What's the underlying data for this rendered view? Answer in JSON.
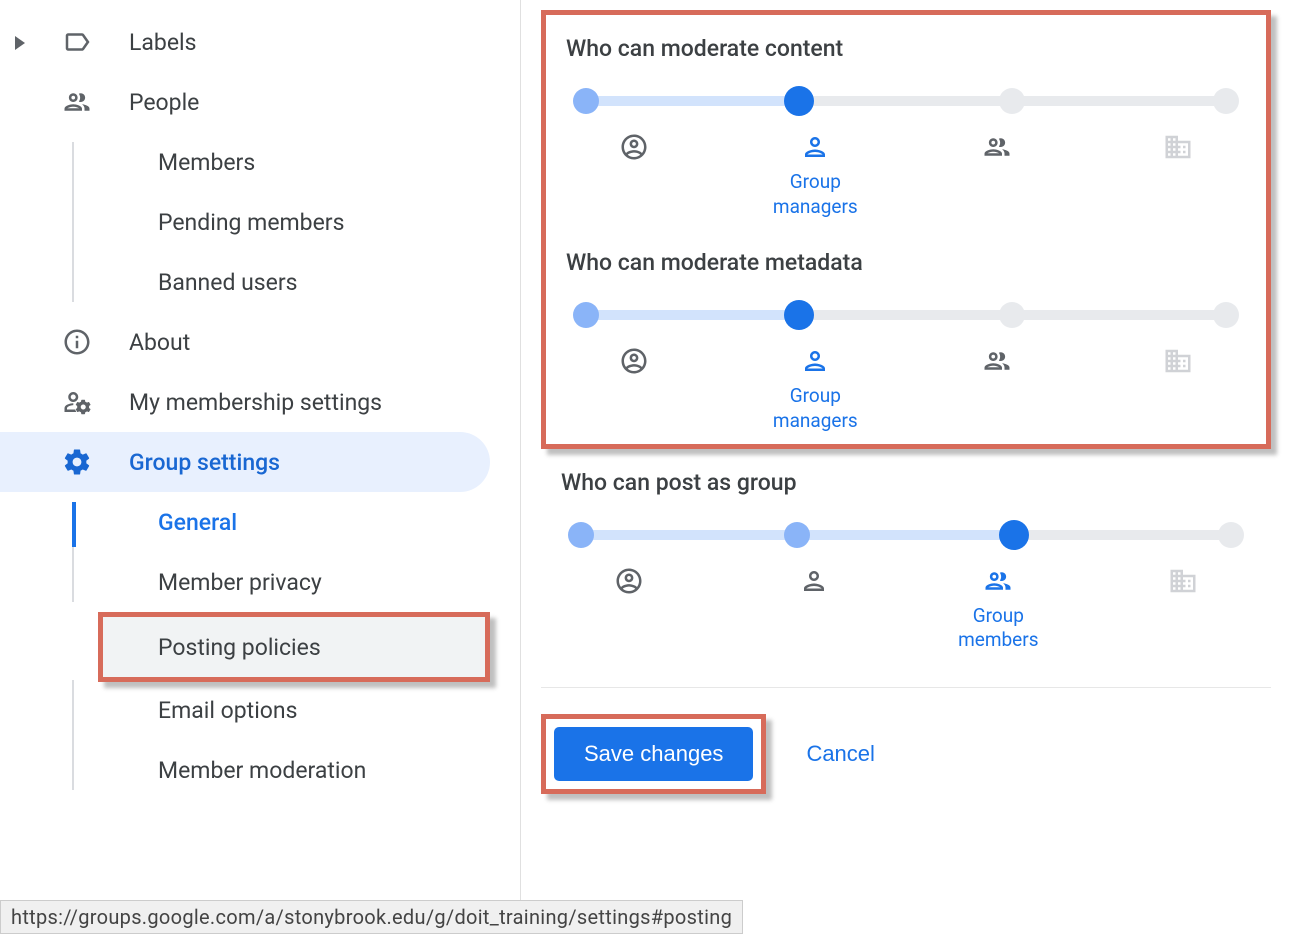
{
  "sidebar": {
    "labels": "Labels",
    "people": "People",
    "people_children": [
      "Members",
      "Pending members",
      "Banned users"
    ],
    "about": "About",
    "my_membership": "My membership settings",
    "group_settings": "Group settings",
    "settings_children": [
      "General",
      "Member privacy",
      "Posting policies",
      "Email options",
      "Member moderation"
    ]
  },
  "main": {
    "sections": [
      {
        "title": "Who can moderate content",
        "selected_index": 1,
        "labels": [
          "",
          "Group managers",
          "",
          ""
        ]
      },
      {
        "title": "Who can moderate metadata",
        "selected_index": 1,
        "labels": [
          "",
          "Group managers",
          "",
          ""
        ]
      },
      {
        "title": "Who can post as group",
        "selected_index": 2,
        "labels": [
          "",
          "",
          "Group members",
          ""
        ]
      }
    ],
    "save": "Save changes",
    "cancel": "Cancel"
  },
  "statusbar": "https://groups.google.com/a/stonybrook.edu/g/doit_training/settings#posting"
}
